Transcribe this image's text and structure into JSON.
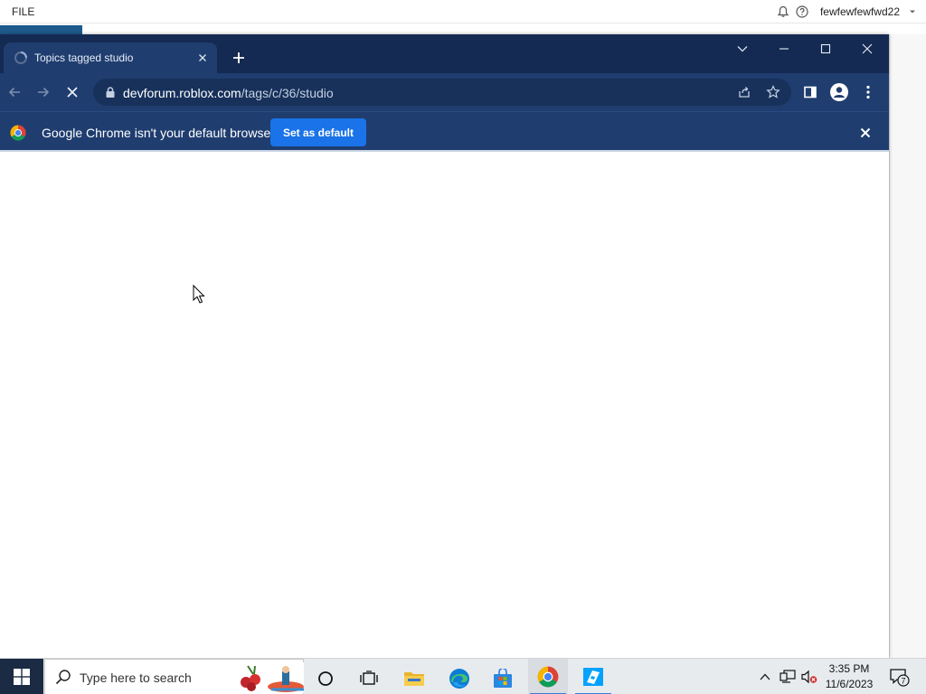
{
  "background_app": {
    "menu_file": "FILE",
    "username": "fewfewfewfwd22"
  },
  "browser": {
    "tab": {
      "title": "Topics tagged studio"
    },
    "address": {
      "host": "devforum.roblox.com",
      "path": "/tags/c/36/studio"
    },
    "infobar": {
      "message": "Google Chrome isn't your default browser",
      "action_label": "Set as default"
    }
  },
  "taskbar": {
    "search_placeholder": "Type here to search",
    "time": "3:35 PM",
    "date": "11/6/2023",
    "notification_count": "7"
  },
  "colors": {
    "chrome_frame": "#142a52",
    "chrome_toolbar": "#1f3d6f",
    "button_blue": "#1a73e8"
  }
}
